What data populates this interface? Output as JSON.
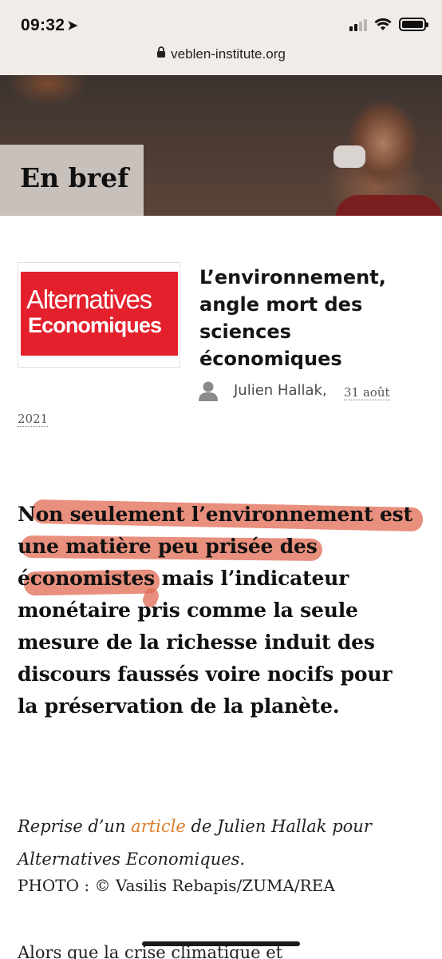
{
  "status_bar": {
    "time": "09:32",
    "location_icon": "location-arrow-icon",
    "signal_icon": "cellular-signal-icon",
    "wifi_icon": "wifi-icon",
    "battery_icon": "battery-icon"
  },
  "browser": {
    "url": "veblen-institute.org",
    "lock_icon": "lock-icon"
  },
  "hero": {
    "label": "En bref"
  },
  "article": {
    "logo": {
      "line1": "Alternatives",
      "line2": "Economiques",
      "brand_color": "#e3202b"
    },
    "title_lines": [
      "L’environnement,",
      "angle mort des",
      "sciences",
      "économiques"
    ],
    "author": "Julien Hallak,",
    "date_day": "31 août",
    "date_year": "2021",
    "lead_lines": [
      "Non seulement l’environnement est",
      "une matière peu prisée des",
      "économistes mais l’indicateur",
      "monétaire pris comme la seule",
      "mesure de la richesse induit des",
      "discours faussés voire nocifs pour",
      "la préservation de la planète."
    ],
    "highlight_color": "#e06a52",
    "credit": {
      "prefix": "Reprise d’un ",
      "link": "article",
      "suffix": " de Julien Hallak pour",
      "line2": "Alternatives Economiques.",
      "link_color": "#e07b27"
    },
    "photo_credit": "PHOTO : © Vasilis Rebapis/ZUMA/REA",
    "next_line": "Alors que la crise climatique et"
  }
}
